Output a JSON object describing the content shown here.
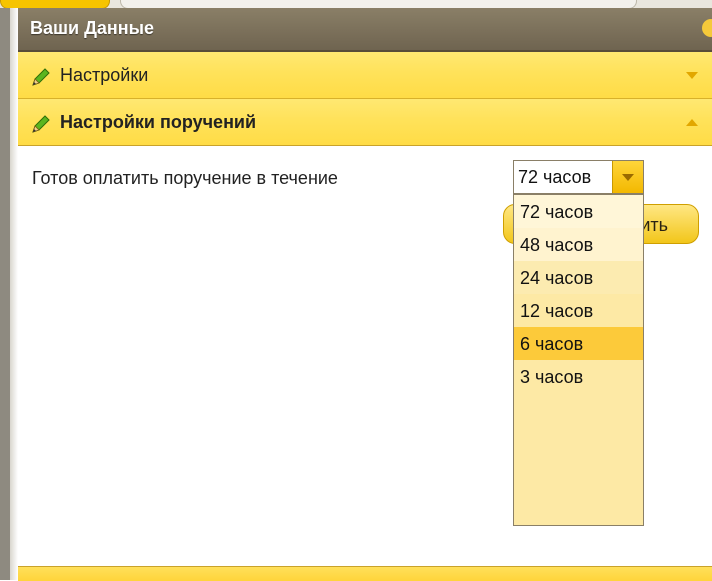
{
  "window": {
    "title": "Ваши Данные"
  },
  "sections": [
    {
      "label": "Настройки",
      "state": "collapsed",
      "icon": "pencil-icon"
    },
    {
      "label": "Настройки поручений",
      "state": "expanded",
      "icon": "pencil-icon"
    }
  ],
  "form": {
    "pay_within_label": "Готов оплатить поручение в течение",
    "select_value": "72 часов",
    "options": [
      "72 часов",
      "48 часов",
      "24 часов",
      "12 часов",
      "6 часов",
      "3 часов"
    ],
    "highlighted_option": "6 часов",
    "save_button_visible_text": "ить"
  },
  "colors": {
    "titlebar": "#7d725c",
    "section_header": "#ffe25a",
    "dropdown_bg": "#fde9a5",
    "highlight": "#fcca3a",
    "accent_arrow": "#e2a700"
  }
}
